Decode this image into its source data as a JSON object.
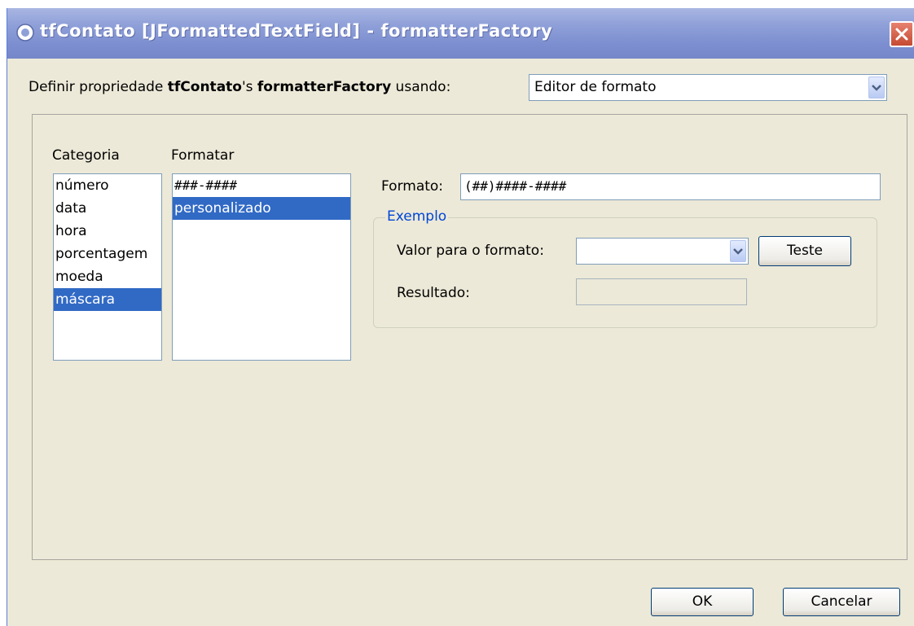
{
  "window": {
    "title": "tfContato [JFormattedTextField] - formatterFactory"
  },
  "property_row": {
    "label_prefix": "Definir propriedade ",
    "component": "tfContato",
    "possessive": "'s ",
    "property": "formatterFactory",
    "label_suffix": " usando:",
    "editor_value": "Editor de formato"
  },
  "category": {
    "header": "Categoria",
    "items": [
      "número",
      "data",
      "hora",
      "porcentagem",
      "moeda",
      "máscara"
    ],
    "selected_index": 5
  },
  "format_list": {
    "header": "Formatar",
    "items": [
      "###-####",
      "personalizado"
    ],
    "selected_index": 1
  },
  "format_field": {
    "label": "Formato:",
    "value": "(##)####-####"
  },
  "example_group": {
    "legend": "Exemplo",
    "value_label": "Valor para o formato:",
    "value": "",
    "test_button": "Teste",
    "result_label": "Resultado:",
    "result_value": ""
  },
  "buttons": {
    "ok": "OK",
    "cancel": "Cancelar"
  },
  "colors": {
    "selection": "#316ac5",
    "group_legend": "#0046d5",
    "dialog_bg": "#ece9d8"
  }
}
